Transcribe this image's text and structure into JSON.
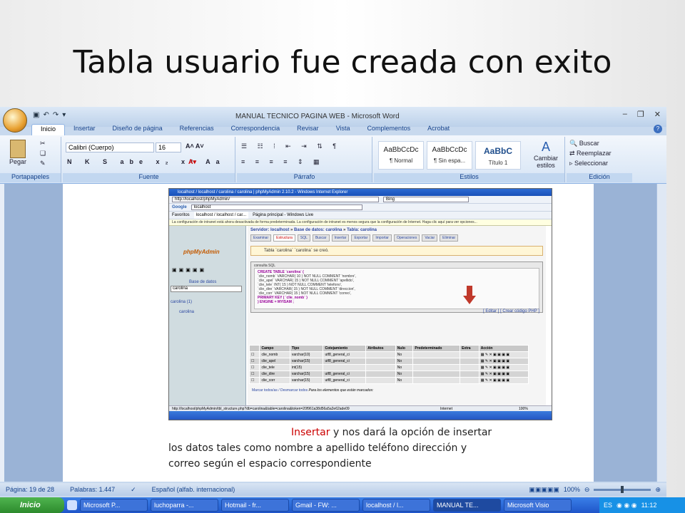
{
  "slide": {
    "title": "Tabla usuario fue creada con exito"
  },
  "word": {
    "window_title": "MANUAL TECNICO PAGINA WEB - Microsoft Word",
    "tabs": [
      "Inicio",
      "Insertar",
      "Diseño de página",
      "Referencias",
      "Correspondencia",
      "Revisar",
      "Vista",
      "Complementos",
      "Acrobat"
    ],
    "ribbon": {
      "paste_label": "Pegar",
      "clipboard_group": "Portapapeles",
      "font_name": "Calibri (Cuerpo)",
      "font_size": "16",
      "font_group": "Fuente",
      "paragraph_group": "Párrafo",
      "styles": [
        {
          "sample": "AaBbCcDc",
          "name": "¶ Normal"
        },
        {
          "sample": "AaBbCcDc",
          "name": "¶ Sin espa..."
        },
        {
          "sample": "AaBbC",
          "name": "Título 1"
        }
      ],
      "change_styles": "Cambiar estilos",
      "styles_group": "Estilos",
      "find": "Buscar",
      "replace": "Reemplazar",
      "select": "Seleccionar",
      "editing_group": "Edición"
    },
    "status": {
      "page": "Página: 19 de 28",
      "words": "Palabras: 1.447",
      "language": "Español (alfab. internacional)",
      "zoom": "100%"
    }
  },
  "inner": {
    "ie_title": "localhost / localhost / carolina / carolina | phpMyAdmin 2.10.2 - Windows Internet Explorer",
    "address": "http://localhost/phpMyAdmin/",
    "search_hint": "Bing",
    "google": "Google",
    "google_text": "localhost",
    "favorites": "Favoritos",
    "fav_tab1": "localhost / localhost / car...",
    "fav_tab2": "Página principal - Windows Live",
    "info_bar": "La configuración de intranet está ahora desactivada de forma predeterminada. La configuración de intranet es menos segura que la configuración de Internet. Haga clic aquí para ver opciones...",
    "logo": "phpMyAdmin",
    "db_label": "Base de datos",
    "db_select": "carolina",
    "db_tree": "carolina (1)",
    "db_table": "carolina",
    "breadcrumb": {
      "server": "Servidor: localhost",
      "db": "Base de datos: carolina",
      "table": "Tabla: carolina"
    },
    "tabs": [
      "Examinar",
      "Estructura",
      "SQL",
      "Buscar",
      "Insertar",
      "Exportar",
      "Importar",
      "Operaciones",
      "Vaciar",
      "Eliminar"
    ],
    "notice": "Tabla `carolina` `carolina` se creó.",
    "sql_title": "consulta SQL",
    "sql_lines": [
      "CREATE TABLE `carolina` (",
      "`clie_nomb` VARCHAR( 10 ) NOT NULL COMMENT 'nombre',",
      "`clie_apel` VARCHAR( 15 ) NOT NULL COMMENT 'apellido',",
      "`clie_tele` INT( 15 ) NOT NULL COMMENT 'telefono',",
      "`clie_dire` VARCHAR( 15 ) NOT NULL COMMENT 'direccion',",
      "`clie_corr` VARCHAR( 15 ) NOT NULL COMMENT 'correo',",
      "PRIMARY KEY ( `clie_nomb` )",
      ") ENGINE = MYISAM ;"
    ],
    "sql_links": "[ Editar ] [ Crear código PHP ]",
    "struct_headers": [
      "Campo",
      "Tipo",
      "Cotejamiento",
      "Atributos",
      "Nulo",
      "Predeterminado",
      "Extra",
      "Acción"
    ],
    "struct_rows": [
      [
        "clie_nomb",
        "varchar(10)",
        "utf8_general_ci",
        "",
        "No"
      ],
      [
        "clie_apel",
        "varchar(15)",
        "utf8_general_ci",
        "",
        "No"
      ],
      [
        "clie_tele",
        "int(15)",
        "",
        "",
        "No"
      ],
      [
        "clie_dire",
        "varchar(15)",
        "utf8_general_ci",
        "",
        "No"
      ],
      [
        "clie_corr",
        "varchar(15)",
        "utf8_general_ci",
        "",
        "No"
      ]
    ],
    "mark_all": "Marcar todos/as / Desmarcar todos",
    "mark_hint": "Para los elementos que están marcados:",
    "status_url": "http://localhost/phpMyAdmin/tbl_structure.php?db=carolina&table=carolina&token=20f961a38d56a5a2e62ade09",
    "internet": "Internet",
    "zoom": "100%"
  },
  "doc": {
    "insertar": "Insertar",
    "line1": " y nos dará la opción de insertar",
    "line2": "los datos tales como nombre a apellido teléfono dirección y",
    "line3": "correo según el espacio correspondiente"
  },
  "taskbar": {
    "start": "Inicio",
    "tasks": [
      "Microsoft P...",
      "luchoparra -...",
      "Hotmail - fr...",
      "Gmail - FW: ...",
      "localhost / l...",
      "MANUAL TE...",
      "Microsoft Visio"
    ],
    "lang": "ES",
    "time": "11:12"
  }
}
